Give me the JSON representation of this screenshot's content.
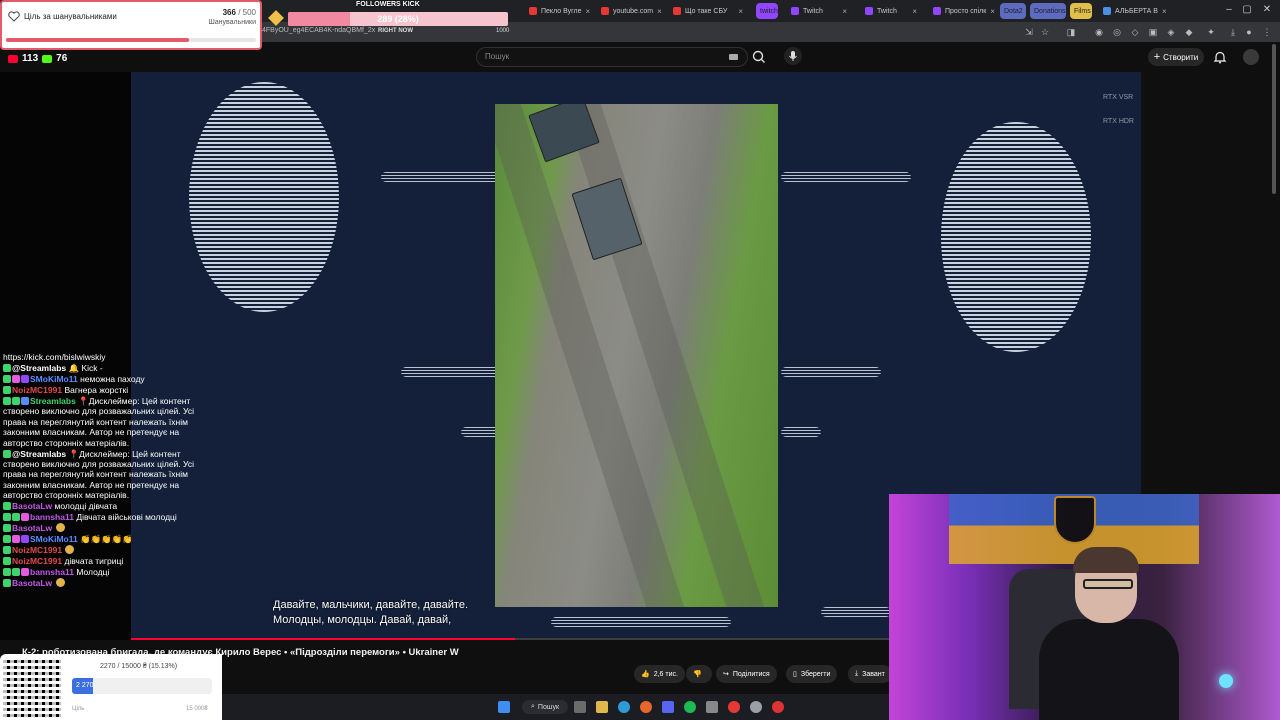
{
  "browser": {
    "tabs": [
      {
        "label": "Пекло Вугле",
        "color": "#e53935"
      },
      {
        "label": "youtube.com",
        "color": "#e53935"
      },
      {
        "label": "Що таке СБУ",
        "color": "#e53935"
      },
      {
        "label": "twitch",
        "color": "#9146ff"
      },
      {
        "label": "Twitch",
        "color": "#9146ff"
      },
      {
        "label": "Twitch",
        "color": "#9146ff"
      },
      {
        "label": "Просто спілк",
        "color": "#9146ff"
      },
      {
        "label": "Dota2",
        "color": "#5c6bc0"
      },
      {
        "label": "Donations",
        "color": "#5c6bc0"
      },
      {
        "label": "Films",
        "color": "#e0c04a"
      },
      {
        "label": "АЛЬБЕРТА В",
        "color": "#4a90e2"
      }
    ],
    "url_fragment": "4FByOU_eg4ECAB4K-ndaQBMf_2x"
  },
  "youtube": {
    "search_placeholder": "Пошук",
    "create_label": "Створити"
  },
  "video": {
    "badge_top": "RTX VSR",
    "badge_bottom": "RTX HDR",
    "subtitle_line1": "Давайте, мальчики, давайте, давайте.",
    "subtitle_line2": "Молодцы, молодцы. Давай, давай,",
    "title": "К-2: роботизована бригада, де командує Кирило Верес • «Підрозділи перемоги» • Ukrainer W",
    "progress": 0.38
  },
  "actions": {
    "likes": "2,6 тис.",
    "share": "Поділитися",
    "save": "Зберегти",
    "download": "Завант"
  },
  "taskbar": {
    "search": "Пошук"
  },
  "overlays": {
    "goal": {
      "label": "Ціль за шанувальниками",
      "current": "366",
      "total": "/ 500",
      "sub": "Шанувальники",
      "fraction": 0.73
    },
    "followers_kick": {
      "title": "FOLLOWERS KICK",
      "value_text": "289 (28%)",
      "now": "RIGHT NOW",
      "max": "1000",
      "fraction": 0.28
    },
    "counters": {
      "youtube": "113",
      "kick": "76"
    },
    "donation": {
      "progress_text": "2270 / 15000 ₴ (15.13%)",
      "amount": "2 270",
      "left_label": "Ціль",
      "right_label": "15 000₴",
      "fraction": 0.1513
    }
  },
  "chat": [
    {
      "user": "",
      "text": "https://kick.com/bislwiwskiy",
      "color": "#ffffff",
      "badges": []
    },
    {
      "user": "@Streamlabs",
      "text": "🔔 Kick -",
      "color": "#ffffff",
      "badges": [
        "#3fd46b"
      ]
    },
    {
      "user": "SMoKiMo11",
      "text": "неможна паходу",
      "color": "#5b8cff",
      "badges": [
        "#3fd46b",
        "#e55adf",
        "#9146ff"
      ]
    },
    {
      "user": "NoizMC1991",
      "text": "Вагнера жорсткі",
      "color": "#e04a4a",
      "badges": [
        "#3fd46b"
      ]
    },
    {
      "user": "Streamlabs",
      "text": "📍Дисклеймер: Цей контент створено виключно для розважальних цілей. Усі права на переглянутий контент належать їхнім законним власникам. Автор не претендує на авторство сторонніх матеріалів.",
      "color": "#3fd46b",
      "badges": [
        "#3fd46b",
        "#3fd46b",
        "#5b8cff"
      ]
    },
    {
      "user": "@Streamlabs",
      "text": "📍Дисклеймер: Цей контент створено виключно для розважальних цілей. Усі права на переглянутий контент належать їхнім законним власникам. Автор не претендує на авторство сторонніх матеріалів.",
      "color": "#ffffff",
      "badges": [
        "#3fd46b"
      ]
    },
    {
      "user": "BasotaLw",
      "text": "молодці дівчата",
      "color": "#c05ae8",
      "badges": [
        "#3fd46b"
      ]
    },
    {
      "user": "bannsha11",
      "text": "Дівчата військові молодці",
      "color": "#c05ae8",
      "badges": [
        "#3fd46b",
        "#3fd46b",
        "#e55adf"
      ]
    },
    {
      "user": "BasotaLw",
      "text": "",
      "color": "#c05ae8",
      "badges": [
        "#3fd46b"
      ]
    },
    {
      "user": "SMoKiMo11",
      "text": "👏👏👏👏👏",
      "color": "#5b8cff",
      "badges": [
        "#3fd46b",
        "#e55adf",
        "#9146ff"
      ]
    },
    {
      "user": "NoizMC1991",
      "text": "",
      "color": "#e04a4a",
      "badges": [
        "#3fd46b"
      ]
    },
    {
      "user": "NoizMC1991",
      "text": "дівчата тигриці",
      "color": "#e04a4a",
      "badges": [
        "#3fd46b"
      ]
    },
    {
      "user": "bannsha11",
      "text": "Молодці",
      "color": "#c05ae8",
      "badges": [
        "#3fd46b",
        "#3fd46b",
        "#e55adf"
      ]
    },
    {
      "user": "BasotaLw",
      "text": "",
      "color": "#c05ae8",
      "badges": [
        "#3fd46b"
      ]
    }
  ]
}
